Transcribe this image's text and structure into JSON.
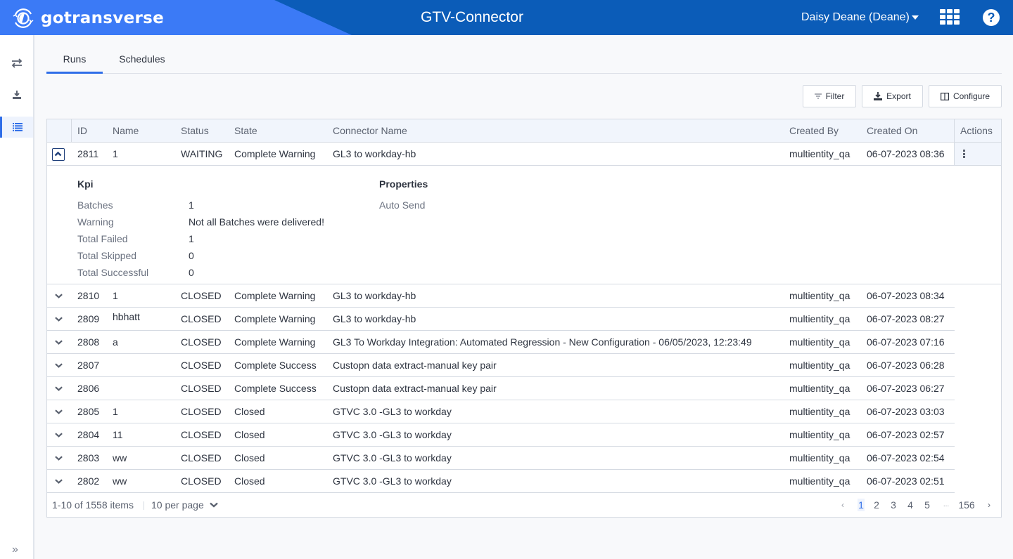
{
  "header": {
    "brand": "gotransverse",
    "title": "GTV-Connector",
    "user": "Daisy Deane (Deane)",
    "icons": [
      "apps-grid-icon",
      "help-icon"
    ]
  },
  "sidebar": {
    "items": [
      {
        "name": "transfer",
        "icon": "⇄",
        "active": false
      },
      {
        "name": "download",
        "icon": "⤓",
        "active": false
      },
      {
        "name": "list",
        "icon": "☰",
        "active": true
      }
    ],
    "expand_icon": "»"
  },
  "tabs": [
    {
      "label": "Runs",
      "active": true
    },
    {
      "label": "Schedules",
      "active": false
    }
  ],
  "toolbar": {
    "filter": "Filter",
    "export": "Export",
    "configure": "Configure"
  },
  "table": {
    "columns": [
      "ID",
      "Name",
      "Status",
      "State",
      "Connector Name",
      "Created By",
      "Created On",
      "Actions"
    ],
    "rows": [
      {
        "id": "2811",
        "name": "1",
        "status": "WAITING",
        "state": "Complete Warning",
        "connector": "GL3 to workday-hb",
        "created_by": "multientity_qa",
        "created_on": "06-07-2023 08:36",
        "expanded": true
      },
      {
        "id": "2810",
        "name": "1",
        "status": "CLOSED",
        "state": "Complete Warning",
        "connector": "GL3 to workday-hb",
        "created_by": "multientity_qa",
        "created_on": "06-07-2023 08:34"
      },
      {
        "id": "2809",
        "name": "hbhatt",
        "status": "CLOSED",
        "state": "Complete Warning",
        "connector": "GL3 to workday-hb",
        "created_by": "multientity_qa",
        "created_on": "06-07-2023 08:27"
      },
      {
        "id": "2808",
        "name": "a",
        "status": "CLOSED",
        "state": "Complete Warning",
        "connector": "GL3 To Workday Integration: Automated Regression -  New Configuration - 06/05/2023, 12:23:49",
        "created_by": "multientity_qa",
        "created_on": "06-07-2023 07:16"
      },
      {
        "id": "2807",
        "name": "",
        "status": "CLOSED",
        "state": "Complete Success",
        "connector": "Custopn data extract-manual key pair",
        "created_by": "multientity_qa",
        "created_on": "06-07-2023 06:28"
      },
      {
        "id": "2806",
        "name": "",
        "status": "CLOSED",
        "state": "Complete Success",
        "connector": "Custopn data extract-manual key pair",
        "created_by": "multientity_qa",
        "created_on": "06-07-2023 06:27"
      },
      {
        "id": "2805",
        "name": "1",
        "status": "CLOSED",
        "state": "Closed",
        "connector": "GTVC 3.0 -GL3 to workday",
        "created_by": "multientity_qa",
        "created_on": "06-07-2023 03:03"
      },
      {
        "id": "2804",
        "name": "11",
        "status": "CLOSED",
        "state": "Closed",
        "connector": "GTVC 3.0 -GL3 to workday",
        "created_by": "multientity_qa",
        "created_on": "06-07-2023 02:57"
      },
      {
        "id": "2803",
        "name": "ww",
        "status": "CLOSED",
        "state": "Closed",
        "connector": "GTVC 3.0 -GL3 to workday",
        "created_by": "multientity_qa",
        "created_on": "06-07-2023 02:54"
      },
      {
        "id": "2802",
        "name": "ww",
        "status": "CLOSED",
        "state": "Closed",
        "connector": "GTVC 3.0 -GL3 to workday",
        "created_by": "multientity_qa",
        "created_on": "06-07-2023 02:51"
      }
    ],
    "detail": {
      "kpi_title": "Kpi",
      "properties_title": "Properties",
      "kpi": [
        {
          "label": "Batches",
          "value": "1"
        },
        {
          "label": "Warning",
          "value": "Not all Batches were delivered!"
        },
        {
          "label": "Total Failed",
          "value": "1"
        },
        {
          "label": "Total Skipped",
          "value": "0"
        },
        {
          "label": "Total Successful",
          "value": "0"
        }
      ],
      "properties": [
        {
          "label": "Auto Send",
          "value": ""
        }
      ]
    }
  },
  "pagination": {
    "info": "1-10 of 1558 items",
    "per_page": "10 per page",
    "prev": "‹",
    "next": "›",
    "pages": [
      "1",
      "2",
      "3",
      "4",
      "5",
      "...",
      "156"
    ],
    "current": "1"
  },
  "colors": {
    "header_bg": "#0b5cb8",
    "brand_bg": "#3b7af6",
    "accent": "#2f6ee8"
  }
}
